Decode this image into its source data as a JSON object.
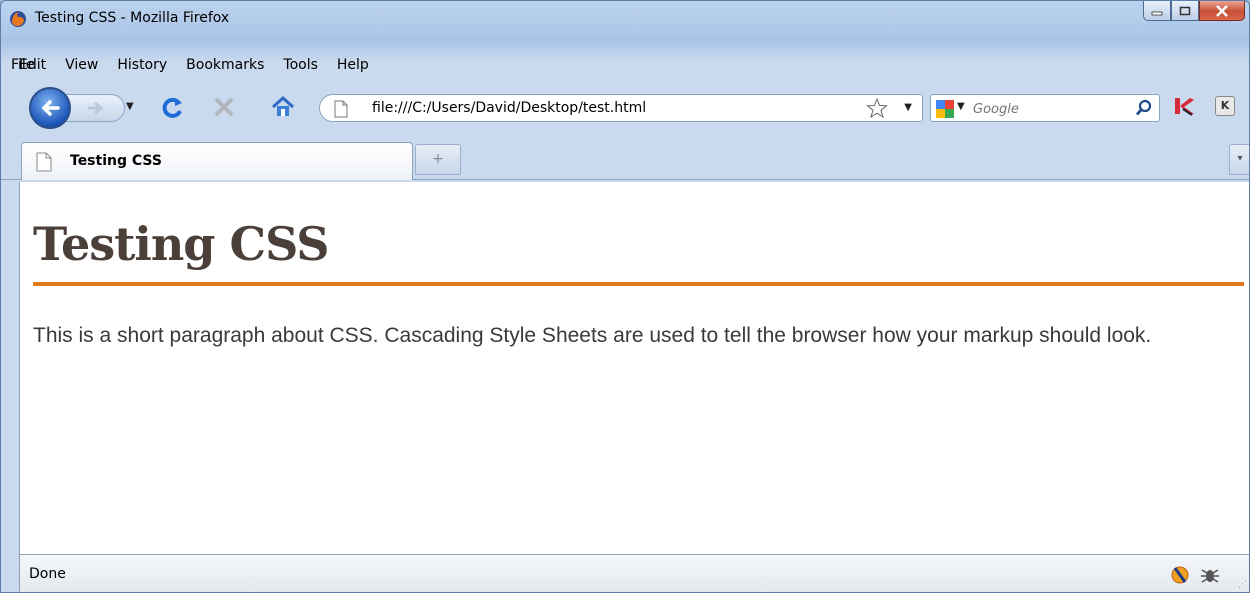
{
  "window": {
    "title": "Testing CSS - Mozilla Firefox"
  },
  "menu": {
    "items": [
      "File",
      "Edit",
      "View",
      "History",
      "Bookmarks",
      "Tools",
      "Help"
    ]
  },
  "navbar": {
    "url": "file:///C:/Users/David/Desktop/test.html",
    "search_placeholder": "Google"
  },
  "tabs": {
    "active_label": "Testing CSS",
    "new_tab_glyph": "+"
  },
  "page": {
    "heading": "Testing CSS",
    "paragraph": "This is a short paragraph about CSS. Cascading Style Sheets are used to tell the browser how your markup should look."
  },
  "status": {
    "text": "Done"
  },
  "colors": {
    "heading": "#4a4039",
    "rule": "#e07a1a",
    "text": "#3a3a3a"
  }
}
